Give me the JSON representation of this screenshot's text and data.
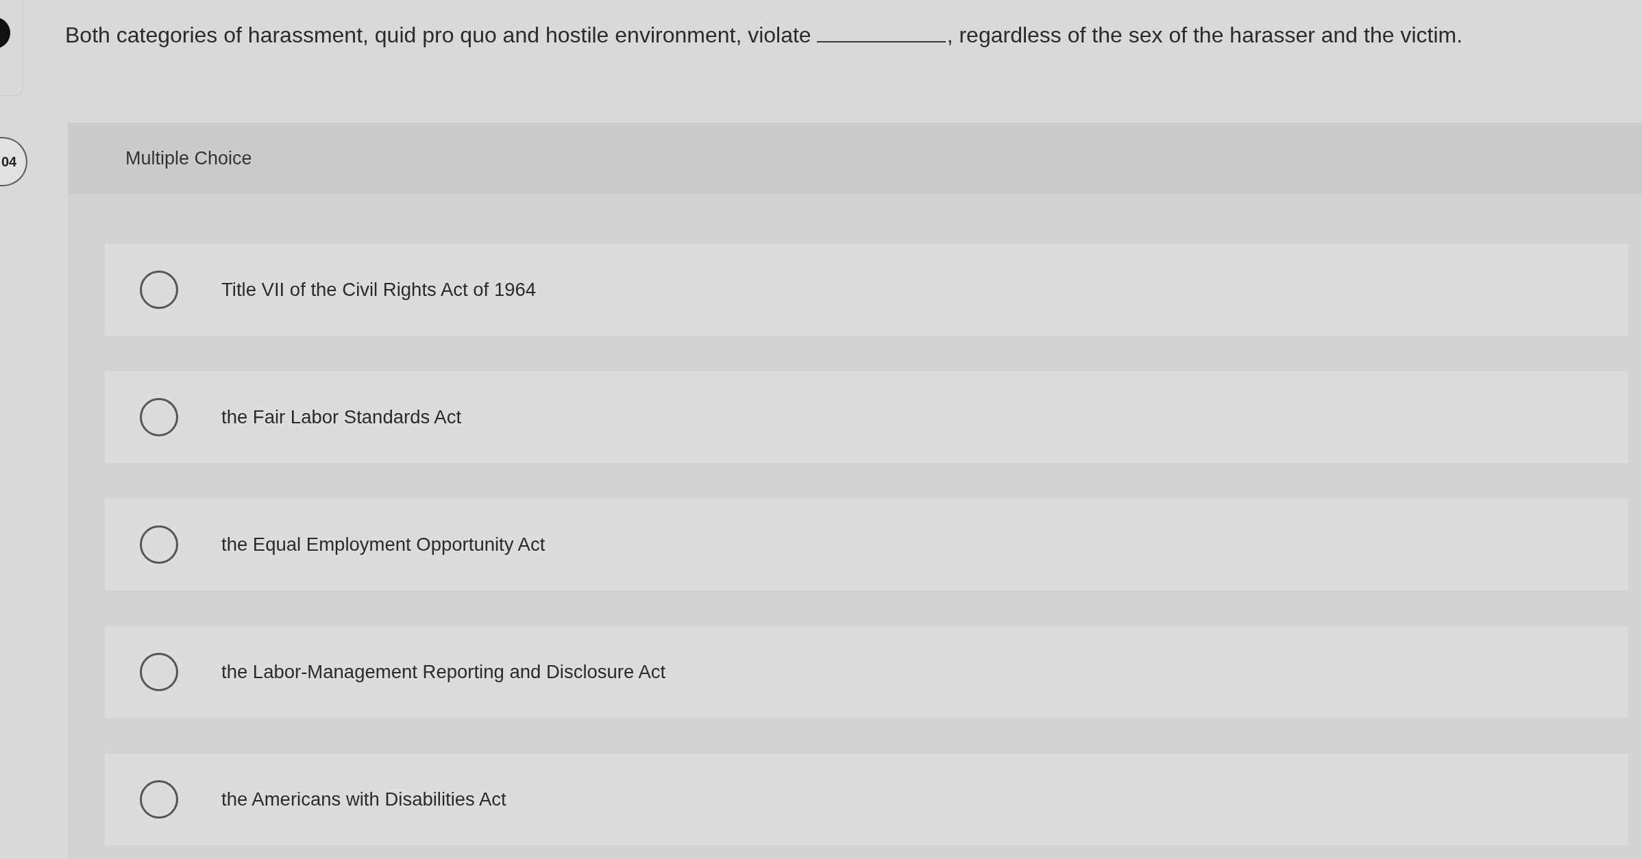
{
  "question": {
    "number": "04",
    "parts": [
      {
        "kind": "text",
        "text": "Both categories of harassment, quid pro quo and hostile environment, violate"
      },
      {
        "kind": "blank"
      },
      {
        "kind": "text",
        "text": ", regardless of the sex of the harasser and the victim."
      }
    ]
  },
  "answer_panel": {
    "title": "Multiple Choice",
    "options": [
      {
        "label": "Title VII of the Civil Rights Act of 1964",
        "selected": false
      },
      {
        "label": "the Fair Labor Standards Act",
        "selected": false
      },
      {
        "label": "the Equal Employment Opportunity Act",
        "selected": false
      },
      {
        "label": "the Labor-Management Reporting and Disclosure Act",
        "selected": false
      },
      {
        "label": "the Americans with Disabilities Act",
        "selected": false
      }
    ]
  }
}
